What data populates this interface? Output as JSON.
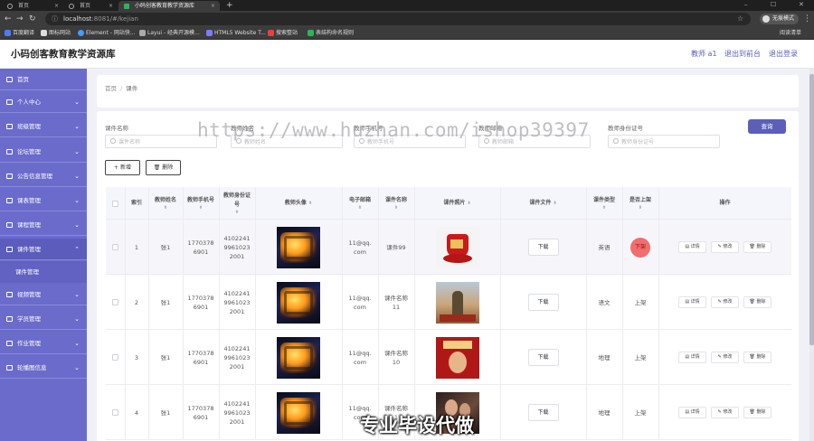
{
  "browser": {
    "tabs": [
      {
        "label": "首页"
      },
      {
        "label": "首页"
      },
      {
        "label": "小码创客教育教学资源库"
      }
    ],
    "new_tab": "+",
    "url_host": "localhost",
    "url_rest": ":8081/#/kejian",
    "guest_label": "无痕模式",
    "bookmarks": [
      "百度翻译",
      "图标网站",
      "Element - 网站快...",
      "Layui - 经典开源模...",
      "HTML5 Website T...",
      "搜索整站",
      "表结构命名规则"
    ],
    "reading_list": "阅读清单"
  },
  "header": {
    "title": "小码创客教育教学资源库",
    "user": "教师 a1",
    "to_front": "退出到前台",
    "logout": "退出登录"
  },
  "sidebar": {
    "items": [
      {
        "label": "首页",
        "has_arrow": false
      },
      {
        "label": "个人中心",
        "has_arrow": true
      },
      {
        "label": "班级管理",
        "has_arrow": true
      },
      {
        "label": "论坛管理",
        "has_arrow": true
      },
      {
        "label": "公告信息管理",
        "has_arrow": true
      },
      {
        "label": "课表管理",
        "has_arrow": true
      },
      {
        "label": "课程管理",
        "has_arrow": true
      },
      {
        "label": "课件管理",
        "has_arrow": true,
        "open": true
      },
      {
        "label": "视频管理",
        "has_arrow": true
      },
      {
        "label": "学员管理",
        "has_arrow": true
      },
      {
        "label": "作业管理",
        "has_arrow": true
      },
      {
        "label": "轮播图信息",
        "has_arrow": true
      }
    ],
    "submenu": "课件管理"
  },
  "breadcrumb": {
    "home": "首页",
    "sep": "/",
    "current": "课件"
  },
  "filters": [
    {
      "label": "课件名称",
      "placeholder": "课件名称"
    },
    {
      "label": "教师姓名",
      "placeholder": "教师姓名"
    },
    {
      "label": "教师手机号",
      "placeholder": "教师手机号"
    },
    {
      "label": "教师邮箱",
      "placeholder": "教师邮箱"
    },
    {
      "label": "教师身份证号",
      "placeholder": "教师身份证号"
    }
  ],
  "query_label": "查询",
  "add_label": "+ 新增",
  "delete_label": "删除",
  "table": {
    "headers": [
      "索引",
      "教师姓名",
      "教师手机号",
      "教师身份证号",
      "教师头像",
      "电子邮箱",
      "课件名称",
      "课件照片",
      "课件文件",
      "课件类型",
      "是否上架",
      "操作"
    ],
    "rows": [
      {
        "index": "1",
        "name": "张1",
        "phone": "17703786901",
        "idcard": "410224199610232001",
        "email": "11@qq.com",
        "course": "课件99",
        "file": "下载",
        "type": "英语",
        "shelf": "",
        "shelf_badge": "下架"
      },
      {
        "index": "2",
        "name": "张1",
        "phone": "17703786901",
        "idcard": "410224199610232001",
        "email": "11@qq.com",
        "course": "课件名称11",
        "file": "下载",
        "type": "语文",
        "shelf": "上架"
      },
      {
        "index": "3",
        "name": "张1",
        "phone": "17703786901",
        "idcard": "410224199610232001",
        "email": "11@qq.com",
        "course": "课件名称10",
        "file": "下载",
        "type": "地理",
        "shelf": "上架"
      },
      {
        "index": "4",
        "name": "张1",
        "phone": "17703786901",
        "idcard": "410224199610232001",
        "email": "11@qq.com",
        "course": "课件名称1",
        "file": "下载",
        "type": "地理",
        "shelf": "上架"
      }
    ],
    "ops": {
      "detail": "详情",
      "edit": "修改",
      "delete": "删除"
    }
  },
  "overlay": {
    "watermark": "https://www.huzhan.com/ishop39397",
    "caption": "专业毕设代做"
  }
}
